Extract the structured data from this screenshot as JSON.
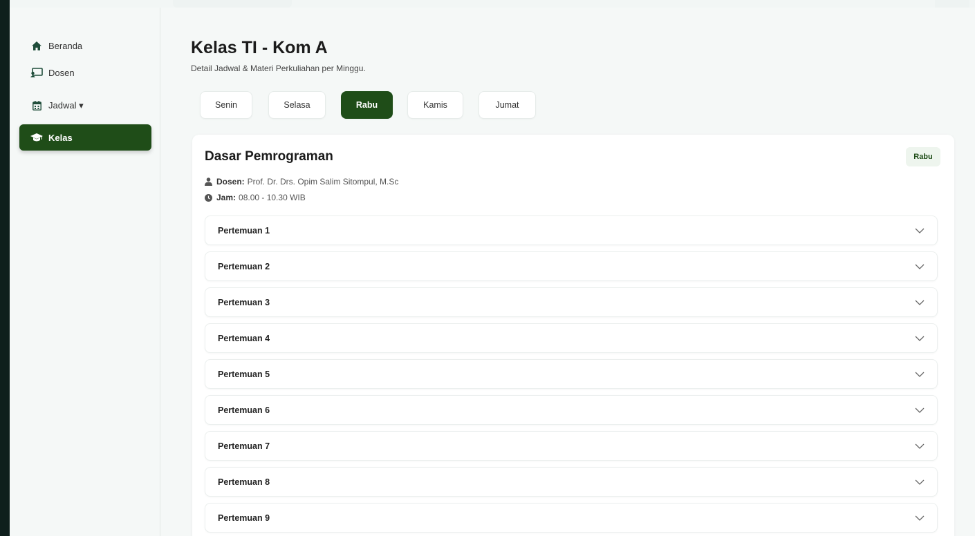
{
  "sidebar": {
    "items": [
      {
        "label": "Beranda",
        "icon": "home-icon"
      },
      {
        "label": "Dosen",
        "icon": "chalkboard-teacher-icon"
      },
      {
        "label": "Jadwal ▾",
        "icon": "calendar-icon"
      },
      {
        "label": "Kelas",
        "icon": "graduation-cap-icon",
        "active": true
      }
    ]
  },
  "header": {
    "title": "Kelas TI - Kom A",
    "subtitle": "Detail Jadwal & Materi Perkuliahan per Minggu."
  },
  "tabs": [
    {
      "label": "Senin"
    },
    {
      "label": "Selasa"
    },
    {
      "label": "Rabu",
      "active": true
    },
    {
      "label": "Kamis"
    },
    {
      "label": "Jumat"
    }
  ],
  "course": {
    "title": "Dasar Pemrograman",
    "day_badge": "Rabu",
    "dosen_label": "Dosen:",
    "dosen_value": "Prof. Dr. Drs. Opim Salim Sitompul, M.Sc",
    "jam_label": "Jam:",
    "jam_value": "08.00 - 10.30 WIB"
  },
  "meetings": [
    {
      "label": "Pertemuan 1"
    },
    {
      "label": "Pertemuan 2"
    },
    {
      "label": "Pertemuan 3"
    },
    {
      "label": "Pertemuan 4"
    },
    {
      "label": "Pertemuan 5"
    },
    {
      "label": "Pertemuan 6"
    },
    {
      "label": "Pertemuan 7"
    },
    {
      "label": "Pertemuan 8"
    },
    {
      "label": "Pertemuan 9"
    }
  ],
  "colors": {
    "accent": "#1f4d18",
    "background": "#f5f8f7",
    "frame": "#0e1f1c"
  }
}
